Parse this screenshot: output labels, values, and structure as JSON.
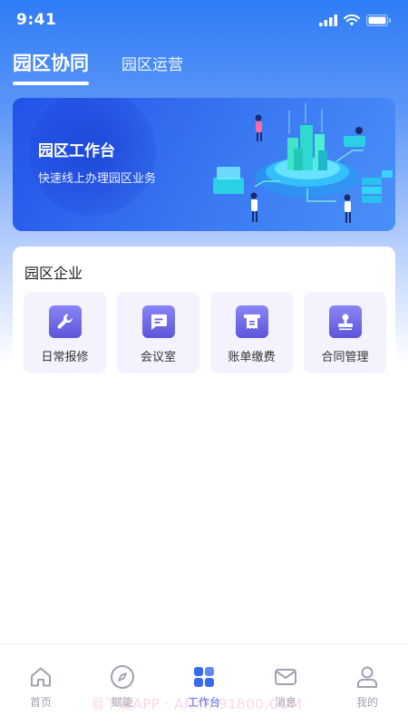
{
  "status_bar": {
    "time": "9:41"
  },
  "tabs": [
    {
      "label": "园区协同",
      "active": true
    },
    {
      "label": "园区运营",
      "active": false
    }
  ],
  "banner": {
    "title": "园区工作台",
    "subtitle": "快速线上办理园区业务"
  },
  "enterprise": {
    "title": "园区企业",
    "items": [
      {
        "label": "日常报修",
        "icon": "wrench-icon"
      },
      {
        "label": "会议室",
        "icon": "chat-icon"
      },
      {
        "label": "账单缴费",
        "icon": "bill-icon"
      },
      {
        "label": "合同管理",
        "icon": "stamp-icon"
      }
    ]
  },
  "bottom_nav": [
    {
      "label": "首页",
      "icon": "home-icon",
      "active": false
    },
    {
      "label": "赋能",
      "icon": "compass-icon",
      "active": false
    },
    {
      "label": "工作台",
      "icon": "grid-icon",
      "active": true
    },
    {
      "label": "消息",
      "icon": "mail-icon",
      "active": false
    },
    {
      "label": "我的",
      "icon": "user-icon",
      "active": false
    }
  ],
  "watermark": "易下载APP · ANXIA91800.COM",
  "colors": {
    "primary": "#2f7cf6",
    "accent_purple": "#5c55d9",
    "nav_active": "#3a6af0",
    "nav_inactive": "#9ea3b0"
  }
}
